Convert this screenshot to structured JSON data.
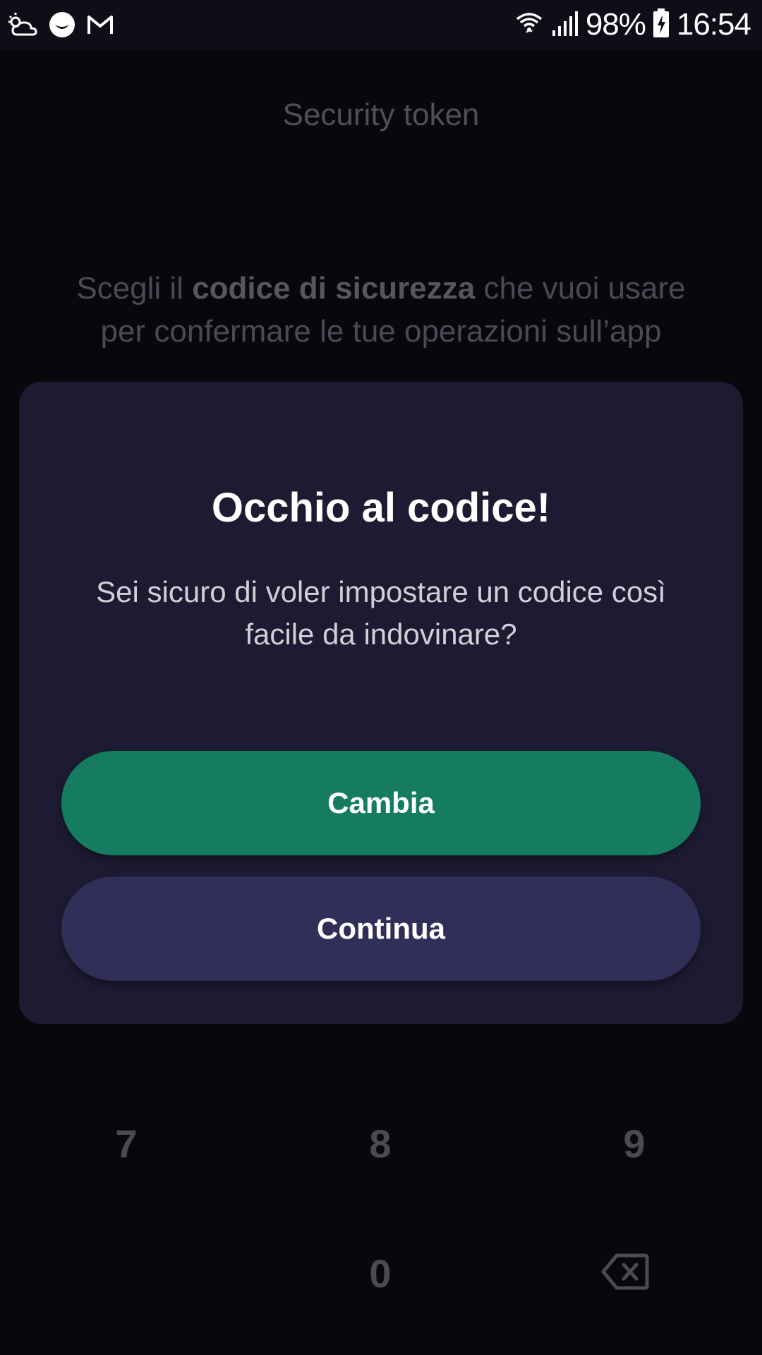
{
  "status_bar": {
    "battery_percent": "98%",
    "time": "16:54",
    "icons": [
      "weather-icon",
      "messenger-icon",
      "gmail-icon",
      "wifi-icon",
      "signal-icon",
      "battery-charging-icon"
    ]
  },
  "background": {
    "title": "Security token",
    "description": {
      "part1": "Scegli il ",
      "bold": "codice di sicurezza",
      "part2": " che vuoi usare per confermare le tue operazioni sull’app"
    },
    "keypad": {
      "row3": [
        "7",
        "8",
        "9"
      ],
      "zero": "0",
      "backspace_icon": "backspace-icon"
    }
  },
  "dialog": {
    "title": "Occhio al codice!",
    "message": "Sei sicuro di voler impostare un codice così facile da indovinare?",
    "primary_button": "Cambia",
    "secondary_button": "Continua"
  },
  "colors": {
    "background": "#07070c",
    "dialog_background": "#1d1b31",
    "primary_button": "#167c5f",
    "secondary_button": "#312e57",
    "text_white": "#ffffff"
  }
}
